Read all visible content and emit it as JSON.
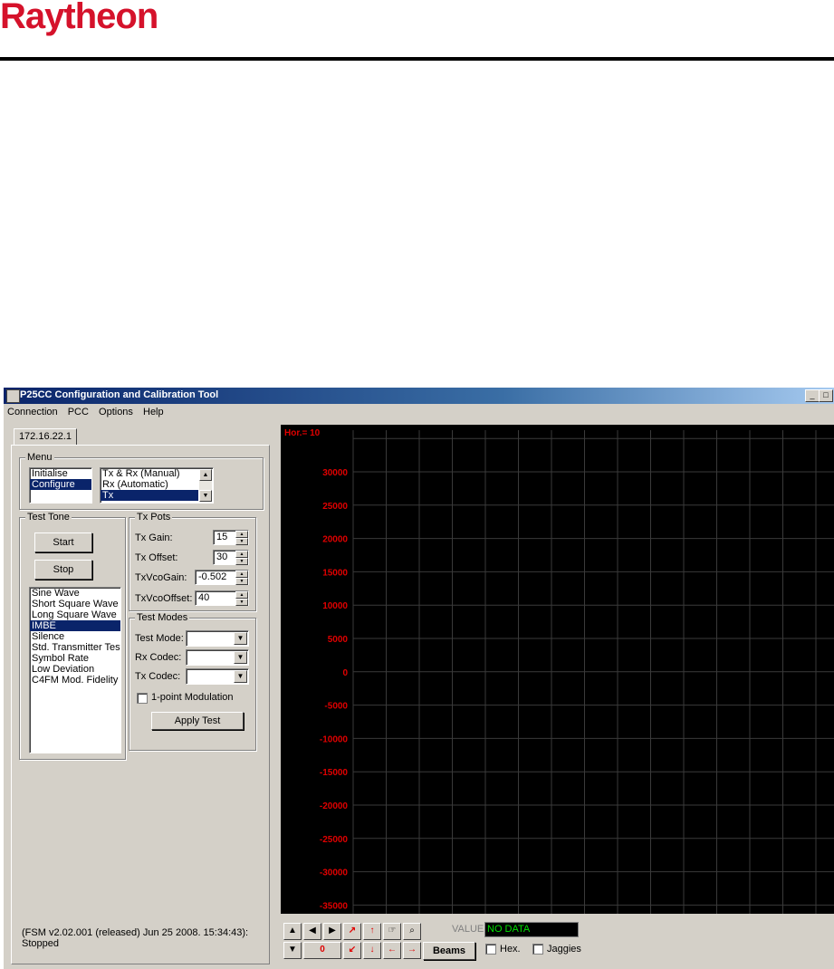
{
  "brand": {
    "name": "Raytheon",
    "color": "#d5122b"
  },
  "window": {
    "title": "P25CC Configuration and Calibration Tool",
    "controls": [
      "_",
      "□",
      "×"
    ]
  },
  "menubar": [
    "Connection",
    "PCC",
    "Options",
    "Help"
  ],
  "tab": {
    "label": "172.16.22.1"
  },
  "menu_group": {
    "label": "Menu",
    "left_list": [
      {
        "text": "Initialise",
        "selected": false
      },
      {
        "text": "Configure",
        "selected": true
      }
    ],
    "right_list": [
      {
        "text": "Tx & Rx (Manual)",
        "selected": false
      },
      {
        "text": "Rx (Automatic)",
        "selected": false
      },
      {
        "text": "Tx",
        "selected": true
      }
    ]
  },
  "test_tone": {
    "label": "Test Tone",
    "start_label": "Start",
    "stop_label": "Stop",
    "items": [
      {
        "text": "Sine Wave",
        "selected": false
      },
      {
        "text": "Short Square Wave",
        "selected": false
      },
      {
        "text": "Long Square Wave",
        "selected": false
      },
      {
        "text": "IMBE",
        "selected": true
      },
      {
        "text": "Silence",
        "selected": false
      },
      {
        "text": "Std. Transmitter Test P",
        "selected": false
      },
      {
        "text": "Symbol Rate",
        "selected": false
      },
      {
        "text": "Low Deviation",
        "selected": false
      },
      {
        "text": "C4FM Mod. Fidelity",
        "selected": false
      }
    ]
  },
  "tx_pots": {
    "label": "Tx Pots",
    "fields": [
      {
        "label": "Tx Gain:",
        "value": "15"
      },
      {
        "label": "Tx Offset:",
        "value": "30"
      },
      {
        "label": "TxVcoGain:",
        "value": "-0.502"
      },
      {
        "label": "TxVcoOffset:",
        "value": "40"
      }
    ]
  },
  "test_modes": {
    "label": "Test Modes",
    "fields": [
      {
        "label": "Test Mode:",
        "value": ""
      },
      {
        "label": "Rx Codec:",
        "value": ""
      },
      {
        "label": "Tx Codec:",
        "value": ""
      }
    ],
    "modulation_label": "1-point Modulation",
    "modulation_checked": false,
    "apply_label": "Apply Test"
  },
  "status_text": "(FSM  v2.02.001  (released) Jun 25 2008. 15:34:43):\nStopped",
  "plot": {
    "hor_label": "Hor.= 10",
    "label_color": "#e00000",
    "grid_color": "#3a3a3a",
    "y_ticks": [
      "30000",
      "25000",
      "20000",
      "15000",
      "10000",
      "5000",
      "0",
      "-5000",
      "-10000",
      "-15000",
      "-20000",
      "-25000",
      "-30000",
      "-35000"
    ]
  },
  "toolbar": {
    "counter": "0",
    "value_label": "VALUE",
    "value_text": "NO DATA",
    "beams_label": "Beams",
    "hex_label": "Hex.",
    "jaggies_label": "Jaggies"
  }
}
